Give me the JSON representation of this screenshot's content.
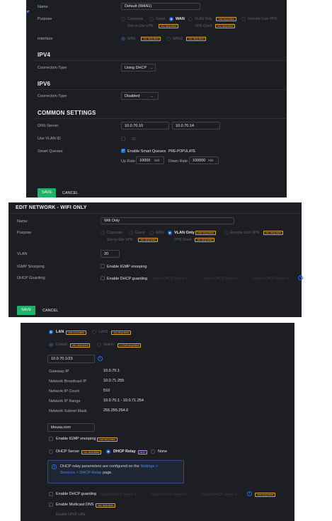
{
  "panel1": {
    "name_label": "Name",
    "name_value": "Default (WAN1)",
    "purpose_label": "Purpose",
    "purpose_opts": [
      "Corporate",
      "Guest",
      "WAN",
      "VLAN Only",
      "Remote User VPN",
      "Site-to-Site VPN",
      "VPN Client"
    ],
    "badge_usw": "USW REQUIRED",
    "badge_usg": "USG REQUIRED",
    "interface_label": "Interface",
    "interface_opts": [
      "WAN",
      "WAN2"
    ],
    "ipv4_title": "IPV4",
    "conn_type_label": "Connection Type",
    "conn_type_v4": "Using DHCP",
    "ipv6_title": "IPV6",
    "conn_type_v6": "Disabled",
    "common_title": "COMMON SETTINGS",
    "dns_label": "DNS Server",
    "dns1": "10.0.70.10",
    "dns2": "10.0.70.14",
    "vlan_label": "Use VLAN ID",
    "vlan_placeholder": "20",
    "sq_label": "Smart Queues",
    "sq_check_label": "Enable Smart Queues",
    "prepop": "PRE-POPULATE",
    "up_label": "Up Rate",
    "up_val": "10000",
    "down_label": "Down Rate",
    "down_val": "100000",
    "unit": "kbit",
    "save": "SAVE",
    "cancel": "CANCEL"
  },
  "panel2": {
    "title": "EDIT NETWORK - WIFI ONLY",
    "name_label": "Name",
    "name_value": "Wifi Only",
    "purpose_label": "Purpose",
    "purpose_opts": [
      "Corporate",
      "Guest",
      "WAN",
      "VLAN Only",
      "Remote User VPN",
      "Site-to-Site VPN",
      "VPN Client"
    ],
    "badge_usw": "USW REQUIRED",
    "badge_usg": "USG REQUIRED",
    "vlan_label": "VLAN",
    "vlan_value": "20",
    "igmp_label": "IGMP Snooping",
    "igmp_check": "Enable IGMP snooping",
    "dhcpg_label": "DHCP Guarding",
    "dhcpg_check": "Enable DHCP guarding",
    "trusted": [
      "Trusted DHCP server 1",
      "Trusted DHCP server 2",
      "Trusted DHCP server 3"
    ],
    "save": "SAVE",
    "cancel": "CANCEL"
  },
  "panel3": {
    "lan": "LAN",
    "lan2": "LAN2",
    "badge_usw": "USW REQUIRED",
    "badge_usg": "USG REQUIRED",
    "badge_l3": "L3 USW REQUIRED",
    "badge_beta": "BETA",
    "default": "Default",
    "switch": "Switch",
    "gateway_subnet": "10.0.70.1/23",
    "rows": [
      {
        "label": "Gateway IP",
        "value": "10.0.70.1"
      },
      {
        "label": "Network Broadcast IP",
        "value": "10.0.71.255"
      },
      {
        "label": "Network IP Count",
        "value": "510"
      },
      {
        "label": "Network IP Range",
        "value": "10.0.70.1 - 10.0.71.254"
      },
      {
        "label": "Network Subnet Mask",
        "value": "255.255.254.0"
      }
    ],
    "domain": "ldvusa.com",
    "igmp_check": "Enable IGMP snooping",
    "dhcp_server": "DHCP Server",
    "dhcp_relay": "DHCP Relay",
    "none": "None",
    "relay_info_1": "DHCP relay parameters are configured on the ",
    "relay_link_1": "Settings >",
    "relay_link_2": "Services > DHCP Relay",
    "relay_info_2": " page.",
    "dhcpg_check": "Enable DHCP guarding",
    "trusted": [
      "Trusted DHCP server 1",
      "Trusted DHCP server 2",
      "Trusted DHCP server 3"
    ],
    "mdns_check": "Enable Multicast DNS",
    "upnp_check": "Enable UPnP LAN"
  },
  "colors": {
    "panel_bg": "#1c1e24",
    "accent": "#1d6fe0",
    "save_green": "#1fb26a",
    "badge_amber": "#e8a838"
  }
}
